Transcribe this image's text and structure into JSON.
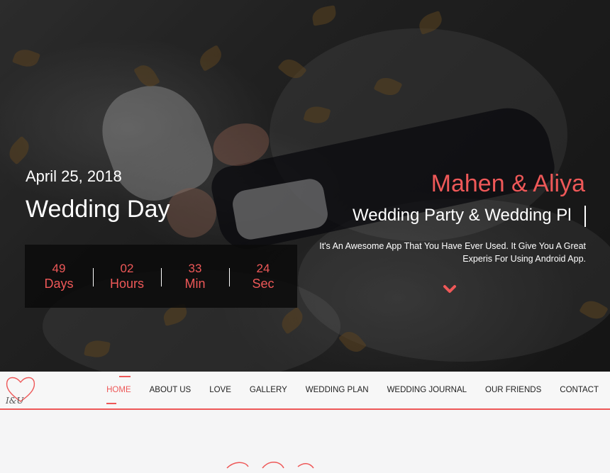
{
  "hero": {
    "date": "April 25, 2018",
    "event": "Wedding Day",
    "names": "Mahen & Aliya",
    "typed_text": "Wedding Party & Wedding Pl",
    "description_line1": "It's An Awesome App That You Have Ever Used. It Give You A Great",
    "description_line2": "Experis For Using Android App.",
    "scroll_icon": "chevron-down-icon"
  },
  "countdown": [
    {
      "value": "49",
      "label": "Days"
    },
    {
      "value": "02",
      "label": "Hours"
    },
    {
      "value": "33",
      "label": "Min"
    },
    {
      "value": "24",
      "label": "Sec"
    }
  ],
  "nav": {
    "logo_icon": "heart-logo-icon",
    "logo_text": "I&U",
    "items": [
      {
        "label": "HOME",
        "active": true
      },
      {
        "label": "ABOUT US"
      },
      {
        "label": "LOVE"
      },
      {
        "label": "GALLERY"
      },
      {
        "label": "WEDDING PLAN"
      },
      {
        "label": "WEDDING JOURNAL"
      },
      {
        "label": "OUR FRIENDS"
      },
      {
        "label": "CONTACT"
      }
    ]
  },
  "colors": {
    "accent": "#ee5858",
    "nav_bg": "#f7f7f7",
    "countdown_bg": "#0a0a0a"
  }
}
